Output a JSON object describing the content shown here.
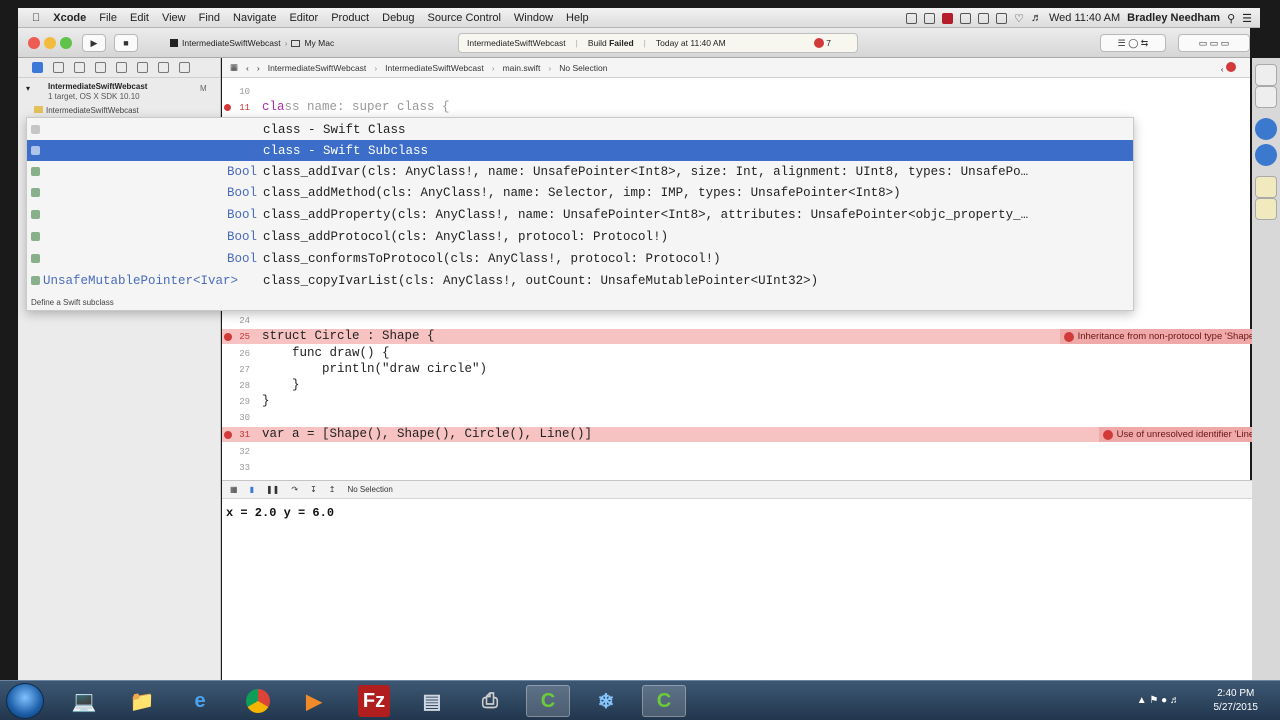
{
  "menubar": {
    "app": "Xcode",
    "items": [
      "File",
      "Edit",
      "View",
      "Find",
      "Navigate",
      "Editor",
      "Product",
      "Debug",
      "Source Control",
      "Window",
      "Help"
    ],
    "clock": "Wed 11:40 AM",
    "user": "Bradley Needham"
  },
  "toolbar": {
    "scheme": "IntermediateSwiftWebcast",
    "destination": "My Mac",
    "activity_project": "IntermediateSwiftWebcast",
    "activity_status_prefix": "Build",
    "activity_status": "Failed",
    "activity_time": "Today at 11:40 AM",
    "error_count": "7"
  },
  "navigator": {
    "project_name": "IntermediateSwiftWebcast",
    "project_sub": "1 target, OS X SDK 10.10",
    "group_name": "IntermediateSwiftWebcast"
  },
  "jumpbar": {
    "crumbs": [
      "IntermediateSwiftWebcast",
      "IntermediateSwiftWebcast",
      "main.swift",
      "No Selection"
    ]
  },
  "code": {
    "line10": "10",
    "line11": "11",
    "line11_text_a": "cla",
    "line11_text_b": "ss name: super class {",
    "line24": "24",
    "line25": "25",
    "line25_text": "struct Circle : Shape {",
    "line25_error": "Inheritance from non-protocol type 'Shape'",
    "line26": "26",
    "line26_text": "    func draw() {",
    "line27": "27",
    "line27_text": "        println(\"draw circle\")",
    "line28": "28",
    "line28_text": "    }",
    "line29": "29",
    "line29_text": "}",
    "line30": "30",
    "line31": "31",
    "line31_text": "var a = [Shape(), Shape(), Circle(), Line()]",
    "line31_error": "Use of unresolved identifier 'Line'",
    "line32": "32",
    "line33": "33"
  },
  "completion": {
    "items": [
      {
        "type": "",
        "text": "class - Swift Class"
      },
      {
        "type": "",
        "text": "class - Swift Subclass"
      },
      {
        "type": "Bool",
        "text": "class_addIvar(cls: AnyClass!, name: UnsafePointer<Int8>, size: Int, alignment: UInt8, types: UnsafePo…"
      },
      {
        "type": "Bool",
        "text": "class_addMethod(cls: AnyClass!, name: Selector, imp: IMP, types: UnsafePointer<Int8>)"
      },
      {
        "type": "Bool",
        "text": "class_addProperty(cls: AnyClass!, name: UnsafePointer<Int8>, attributes: UnsafePointer<objc_property_…"
      },
      {
        "type": "Bool",
        "text": "class_addProtocol(cls: AnyClass!, protocol: Protocol!)"
      },
      {
        "type": "Bool",
        "text": "class_conformsToProtocol(cls: AnyClass!, protocol: Protocol!)"
      },
      {
        "type": "UnsafeMutablePointer<Ivar>",
        "text": "class_copyIvarList(cls: AnyClass!, outCount: UnsafeMutablePointer<UInt32>)"
      }
    ],
    "selected_index": 1,
    "description": "Define a Swift subclass"
  },
  "debug": {
    "selection": "No Selection",
    "console_output": "x = 2.0 y = 6.0"
  },
  "taskbar": {
    "time": "2:40 PM",
    "date": "5/27/2015"
  },
  "colors": {
    "error_row": "#f6c2c2",
    "selection": "#3c6ec9"
  }
}
